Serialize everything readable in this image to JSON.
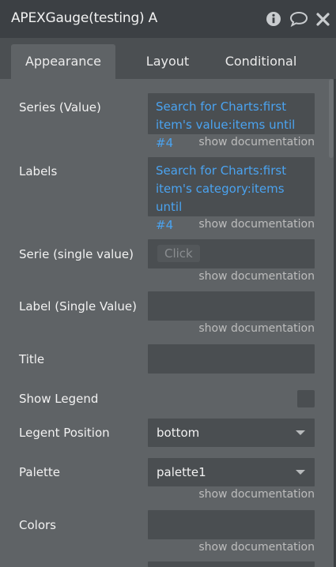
{
  "header": {
    "title": "APEXGauge(testing) A",
    "icons": [
      "info-icon",
      "comment-icon",
      "close-icon"
    ]
  },
  "tabs": [
    {
      "label": "Appearance",
      "active": true
    },
    {
      "label": "Layout",
      "active": false
    },
    {
      "label": "Conditional",
      "active": false
    }
  ],
  "doc_link": "show documentation",
  "properties": {
    "series_value": {
      "label": "Series (Value)",
      "line1": "Search for Charts:first",
      "line2": "item's value:items until #4"
    },
    "labels": {
      "label": "Labels",
      "line1": "Search for Charts:first",
      "line2": "item's category:items until",
      "line3": "#4"
    },
    "serie_single": {
      "label": "Serie (single value)",
      "button": "Click"
    },
    "label_single": {
      "label": "Label (Single Value)",
      "value": ""
    },
    "title": {
      "label": "Title",
      "value": ""
    },
    "show_legend": {
      "label": "Show Legend",
      "checked": false
    },
    "legend_position": {
      "label": "Legent Position",
      "value": "bottom"
    },
    "palette": {
      "label": "Palette",
      "value": "palette1"
    },
    "colors": {
      "label": "Colors",
      "value": ""
    }
  },
  "colors": {
    "panel_bg": "#5f6366",
    "titlebar_bg": "#3c4044",
    "tabbar_bg": "#4b4f52",
    "field_bg": "#4a4e51",
    "dynamic_text": "#4aa3f0",
    "doc_text": "#bdbdbd"
  }
}
